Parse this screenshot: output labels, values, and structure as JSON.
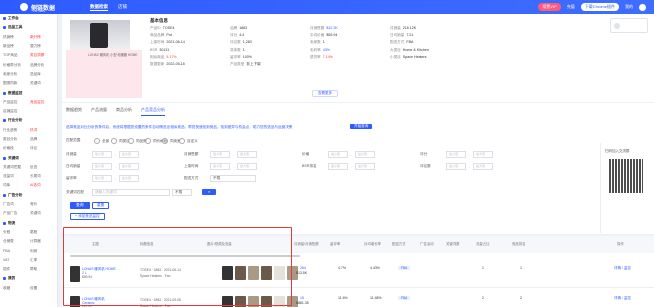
{
  "topbar": {
    "logo_text": "侧链数据",
    "logo_sub": "For store",
    "nav": [
      "数据检索",
      "店铺"
    ],
    "right": [
      "续费VIP",
      "充值",
      "下载Chrome插件",
      "我的"
    ],
    "vip_label": "VIP"
  },
  "sidebar": {
    "rows": [
      {
        "type": "head",
        "text": "工作台"
      },
      {
        "type": "head",
        "text": "选品工具"
      },
      {
        "type": "pair",
        "cells": [
          "热销榜",
          "飙升榜"
        ],
        "hot": [
          false,
          true
        ]
      },
      {
        "type": "pair",
        "cells": [
          "新品榜",
          "潜力榜"
        ],
        "hot": [
          false,
          false
        ]
      },
      {
        "type": "pair",
        "cells": [
          "TOP商品",
          "类目洞察"
        ],
        "hot": [
          false,
          true
        ]
      },
      {
        "type": "pair",
        "cells": [
          "价格带分析",
          "品牌分析"
        ],
        "hot": [
          false,
          false
        ]
      },
      {
        "type": "pair",
        "cells": [
          "卖家分析",
          "选品库"
        ],
        "hot": [
          false,
          false
        ]
      },
      {
        "type": "pair",
        "cells": [
          "图搜同款",
          "关键词"
        ],
        "hot": [
          false,
          false
        ]
      },
      {
        "type": "head",
        "text": "数据监控"
      },
      {
        "type": "pair",
        "cells": [
          "产品监控",
          "竞品监控"
        ],
        "hot": [
          false,
          true
        ]
      },
      {
        "type": "pair",
        "cells": [
          "店铺监控",
          ""
        ],
        "hot": [
          false,
          false
        ]
      },
      {
        "type": "head",
        "text": "行业分析"
      },
      {
        "type": "pair",
        "cells": [
          "行业趋势",
          "热词"
        ],
        "hot": [
          false,
          true
        ]
      },
      {
        "type": "pair",
        "cells": [
          "类目分析",
          "品牌"
        ],
        "hot": [
          false,
          false
        ]
      },
      {
        "type": "pair",
        "cells": [
          "价格段",
          "评论"
        ],
        "hot": [
          false,
          false
        ]
      },
      {
        "type": "head",
        "text": "关键词"
      },
      {
        "type": "pair",
        "cells": [
          "关键词挖掘",
          "反查"
        ],
        "hot": [
          false,
          false
        ]
      },
      {
        "type": "pair",
        "cells": [
          "流量词",
          "长尾词"
        ],
        "hot": [
          false,
          false
        ]
      },
      {
        "type": "pair",
        "cells": [
          "词库",
          "AI选词"
        ],
        "hot": [
          false,
          true
        ]
      },
      {
        "type": "head",
        "text": "广告分析"
      },
      {
        "type": "pair",
        "cells": [
          "广告词",
          "竞价"
        ],
        "hot": [
          false,
          false
        ]
      },
      {
        "type": "pair",
        "cells": [
          "产品广告",
          "关键词"
        ],
        "hot": [
          false,
          false
        ]
      },
      {
        "type": "head",
        "text": "物流"
      },
      {
        "type": "pair",
        "cells": [
          "头程",
          "尾程"
        ],
        "hot": [
          false,
          false
        ]
      },
      {
        "type": "pair",
        "cells": [
          "仓储费",
          "计算器"
        ],
        "hot": [
          false,
          false
        ]
      },
      {
        "type": "pair",
        "cells": [
          "FBA",
          "利润"
        ],
        "hot": [
          false,
          false
        ]
      },
      {
        "type": "pair",
        "cells": [
          "VAT",
          "汇率"
        ],
        "hot": [
          false,
          false
        ]
      },
      {
        "type": "pair",
        "cells": [
          "插件",
          "帮助"
        ],
        "hot": [
          false,
          false
        ]
      },
      {
        "type": "head",
        "text": "我的"
      },
      {
        "type": "pair",
        "cells": [
          "收藏",
          "设置"
        ],
        "hot": [
          false,
          false
        ]
      }
    ]
  },
  "product": {
    "title": "基本信息",
    "pink_text": "LOHAS 暖风机 小型 电暖器 HOME",
    "stats": [
      {
        "label": "产品ID",
        "value": "TOSE4",
        "style": ""
      },
      {
        "label": "品牌",
        "value": "1883",
        "style": ""
      },
      {
        "label": "月销售额",
        "value": "$12.2K",
        "style": "hl"
      },
      {
        "label": "月销量",
        "value": "216.12K",
        "style": ""
      },
      {
        "label": "商品品牌",
        "value": "Pot",
        "style": ""
      },
      {
        "label": "评分",
        "value": "4.4",
        "style": ""
      },
      {
        "label": "平均价格",
        "value": "$59.94",
        "style": ""
      },
      {
        "label": "日均销量",
        "value": "7.21",
        "style": ""
      },
      {
        "label": "上架时间",
        "value": "2021-06-14",
        "style": ""
      },
      {
        "label": "评论数",
        "value": "1,283",
        "style": ""
      },
      {
        "label": "卖家数",
        "value": "1",
        "style": ""
      },
      {
        "label": "配送方式",
        "value": "FBA",
        "style": ""
      },
      {
        "label": "BSR",
        "value": "30131",
        "style": ""
      },
      {
        "label": "变体数",
        "value": "1",
        "style": ""
      },
      {
        "label": "毛利率",
        "value": "43%",
        "style": "hl"
      },
      {
        "label": "大类目",
        "value": "Home & Kitchen",
        "style": ""
      },
      {
        "label": "相似商品",
        "value": "5.17%",
        "style": "red"
      },
      {
        "label": "留评率",
        "value": "100%",
        "style": ""
      },
      {
        "label": "退货率",
        "value": "7.14%",
        "style": "red"
      },
      {
        "label": "小类目",
        "value": "Space Heaters",
        "style": ""
      },
      {
        "label": "数据更新",
        "value": "2022-05-15",
        "style": ""
      },
      {
        "label": "产品类型",
        "value": "非上下架",
        "style": ""
      }
    ],
    "more_label": "查看更多"
  },
  "filter": {
    "tabs": [
      "数据趋势",
      "产品流量",
      "商品分析",
      "产品竞品分析"
    ],
    "active_tab": 3,
    "description": "选择竞品对比分析的条件后，系统将根据您设置的条件自动筛选出相似竞品，帮您快速找到竞品，找到差异与机会点，助力您的选品与运营决策",
    "desc_btn": "开始查询",
    "qr_label": "扫码加入交流群",
    "label_scope": "匹配范围",
    "scope_opts": [
      "全部",
      "同类目",
      "同品牌",
      "同价格段",
      "同卖家",
      "自定义"
    ],
    "labels": [
      "月销量",
      "月销售额",
      "价格",
      "评分",
      "日均销量",
      "上架时间",
      "BSR排名",
      "评论数",
      "留评率",
      "配送方式",
      "关键词匹配",
      "ASIN"
    ],
    "ph_min": "最小值",
    "ph_max": "最大值",
    "sel_value": "不限",
    "keyword_ph": "请输入关键词",
    "search_label": "查询",
    "reset_label": "重置",
    "add_label": "+ 添加竞品监控"
  },
  "table": {
    "headers": [
      "主图",
      "标题信息",
      "图片/视频及流量",
      "月销量/月销售额",
      "留评率",
      "月均增长率",
      "配送方式",
      "广告活动",
      "关键词数",
      "流量占比",
      "竞品排名",
      "操作"
    ],
    "rows": [
      {
        "title": "LOHAS 暖风机 HOME 2 L",
        "sub": "$59.94",
        "line1": "TOSE4 · 1883 · 2021-06-14",
        "line2": "Space Heaters · Fan",
        "v1": "264",
        "v1b": "$13.5K",
        "v2": "4.7%",
        "v3": "4.43%",
        "tag": "FBA",
        "v4": "1",
        "v5": "1",
        "op": "详情 / 监控"
      },
      {
        "title": "LOHAS 暖风机 Ceramic",
        "sub": "$53.94",
        "line1": "TOSE4 · 1883 · 2021-09-08",
        "line2": "Space Heaters · Fan",
        "v1": "15",
        "v1b": "$881.35",
        "v2": "11.6%",
        "v3": "11.48%",
        "tag": "FBA",
        "v4": "2",
        "v5": "2",
        "op": "详情 / 监控"
      }
    ]
  }
}
